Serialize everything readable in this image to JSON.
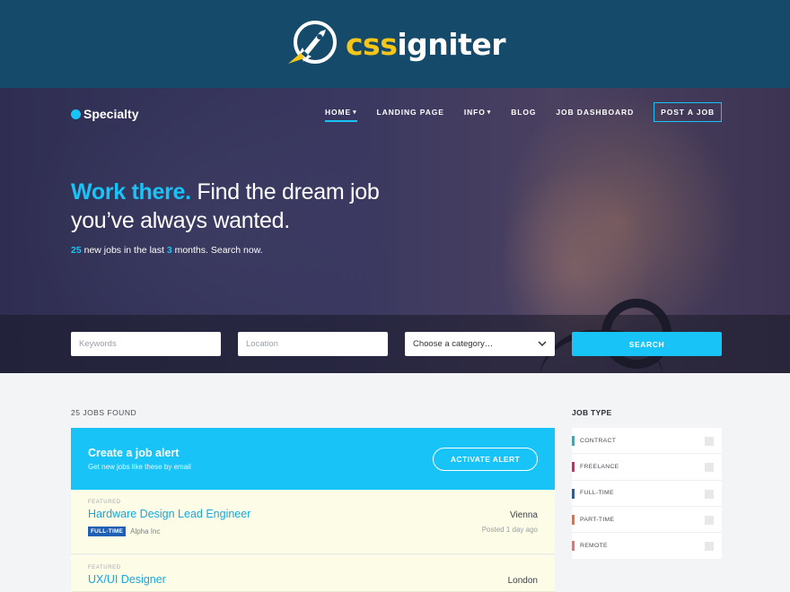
{
  "brand": {
    "name_part1": "css",
    "name_part2": "igniter",
    "logo_icon": "rocket-icon"
  },
  "site": {
    "logo_text": "Specialty"
  },
  "nav": {
    "items": [
      {
        "label": "HOME",
        "dropdown": true,
        "active": true
      },
      {
        "label": "LANDING PAGE",
        "dropdown": false
      },
      {
        "label": "INFO",
        "dropdown": true
      },
      {
        "label": "BLOG",
        "dropdown": false
      },
      {
        "label": "JOB DASHBOARD",
        "dropdown": false
      }
    ],
    "post_job_label": "POST A JOB"
  },
  "hero": {
    "headline_accent": "Work there.",
    "headline_rest": " Find the dream job",
    "headline_line2": "you’ve always wanted.",
    "sub_count": "25",
    "sub_mid": " new jobs in the last ",
    "sub_months": "3",
    "sub_end": " months. Search now."
  },
  "search": {
    "keywords_placeholder": "Keywords",
    "location_placeholder": "Location",
    "category_value": "Choose a category…",
    "button_label": "SEARCH"
  },
  "results": {
    "count_label": "25 JOBS FOUND"
  },
  "alert": {
    "title": "Create a job alert",
    "subtitle": "Get new jobs like these by email",
    "button_label": "ACTIVATE ALERT"
  },
  "jobs": [
    {
      "featured": "FEATURED",
      "title": "Hardware Design Lead Engineer",
      "type": "FULL-TIME",
      "company": "Alpha Inc",
      "location": "Vienna",
      "posted": "Posted 1 day ago"
    },
    {
      "featured": "FEATURED",
      "title": "UX/UI Designer",
      "location": "London"
    }
  ],
  "sidebar": {
    "heading": "JOB TYPE",
    "items": [
      {
        "label": "CONTRACT",
        "color": "#1fb5c5"
      },
      {
        "label": "FREELANCE",
        "color": "#e0245e"
      },
      {
        "label": "FULL-TIME",
        "color": "#1f5fb4"
      },
      {
        "label": "PART-TIME",
        "color": "#f26a3d"
      },
      {
        "label": "REMOTE",
        "color": "#f07070"
      }
    ]
  },
  "colors": {
    "accent": "#17c3f7",
    "brand_bar": "#154a6b",
    "brand_highlight": "#f5c518"
  }
}
